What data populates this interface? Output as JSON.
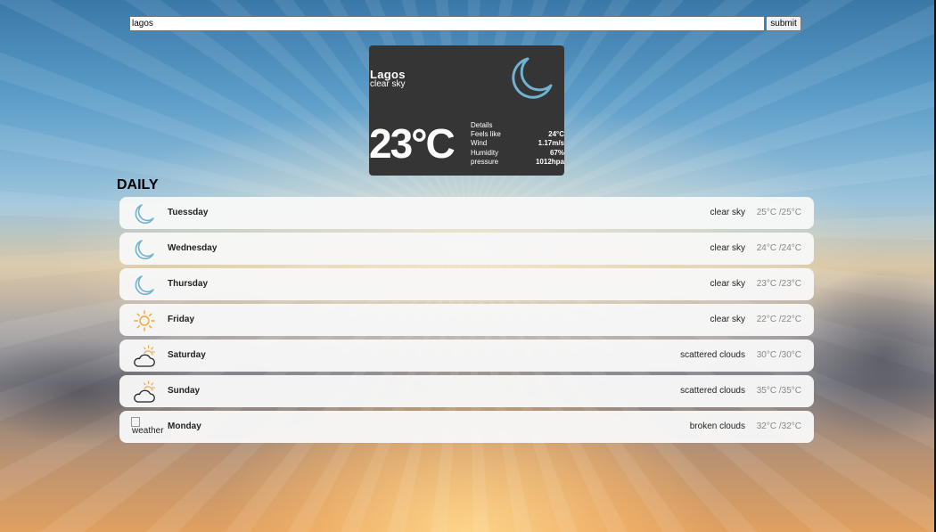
{
  "search": {
    "value": "lagos",
    "submit_label": "submit"
  },
  "current": {
    "city": "Lagos",
    "condition": "clear sky",
    "temperature": "23°C",
    "icon": "moon-icon",
    "details_label": "Details",
    "details": [
      {
        "label": "Feels like",
        "value": "24°C"
      },
      {
        "label": "Wind",
        "value": "1.17m/s"
      },
      {
        "label": "Humidity",
        "value": "67%"
      },
      {
        "label": "pressure",
        "value": "1012hpa"
      }
    ]
  },
  "daily": {
    "title": "DAILY",
    "days": [
      {
        "name": "Tuessday",
        "condition": "clear sky",
        "temps": "25°C /25°C",
        "icon": "moon-icon"
      },
      {
        "name": "Wednesday",
        "condition": "clear sky",
        "temps": "24°C /24°C",
        "icon": "moon-icon"
      },
      {
        "name": "Thursday",
        "condition": "clear sky",
        "temps": "23°C /23°C",
        "icon": "moon-icon"
      },
      {
        "name": "Friday",
        "condition": "clear sky",
        "temps": "22°C /22°C",
        "icon": "sun-icon"
      },
      {
        "name": "Saturday",
        "condition": "scattered clouds",
        "temps": "30°C /30°C",
        "icon": "partly-cloudy-icon"
      },
      {
        "name": "Sunday",
        "condition": "scattered clouds",
        "temps": "35°C /35°C",
        "icon": "partly-cloudy-icon"
      },
      {
        "name": "Monday",
        "condition": "broken clouds",
        "temps": "32°C /32°C",
        "icon": "broken-image-icon",
        "icon_alt": "weather"
      }
    ]
  },
  "colors": {
    "card_bg": "#353535",
    "moon_stroke": "#6fb3d2",
    "sun_stroke": "#f2a33a",
    "row_bg": "#f7f7f7"
  }
}
